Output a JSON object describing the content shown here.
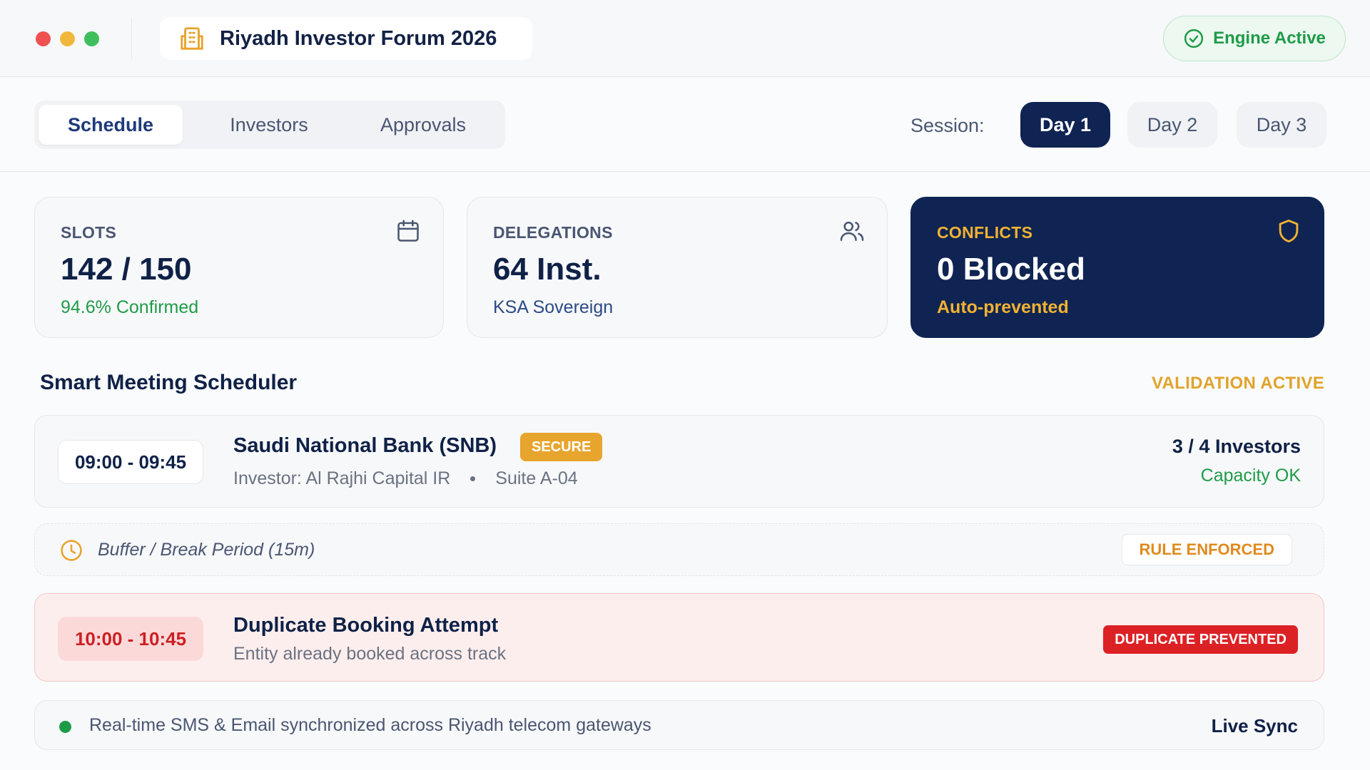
{
  "window": {
    "title": "Riyadh Investor Forum 2026",
    "app_icon": "building-icon",
    "engine_status": "Engine Active",
    "engine_icon": "check-circle-icon"
  },
  "nav": {
    "tabs": [
      {
        "label": "Schedule",
        "active": true
      },
      {
        "label": "Investors",
        "active": false
      },
      {
        "label": "Approvals",
        "active": false
      }
    ],
    "session_label": "Session:",
    "days": [
      {
        "label": "Day 1",
        "active": true
      },
      {
        "label": "Day 2",
        "active": false
      },
      {
        "label": "Day 3",
        "active": false
      }
    ]
  },
  "stats": [
    {
      "label": "SLOTS",
      "value": "142 / 150",
      "sub": "94.6% Confirmed",
      "icon": "calendar-icon"
    },
    {
      "label": "DELEGATIONS",
      "value": "64 Inst.",
      "sub": "KSA Sovereign",
      "icon": "users-icon"
    },
    {
      "label": "CONFLICTS",
      "value": "0 Blocked",
      "sub": "Auto-prevented",
      "icon": "shield-icon"
    }
  ],
  "scheduler": {
    "title": "Smart Meeting Scheduler",
    "status": "VALIDATION ACTIVE",
    "meeting": {
      "time": "09:00 - 09:45",
      "title": "Saudi National Bank (SNB)",
      "badge": "SECURE",
      "investor": "Investor: Al Rajhi Capital IR",
      "location": "Suite A-04",
      "capacity": "3 / 4 Investors",
      "capacity_status": "Capacity OK"
    },
    "buffer": {
      "icon": "clock-icon",
      "label": "Buffer / Break Period (15m)",
      "badge": "RULE ENFORCED"
    },
    "duplicate": {
      "time": "10:00 - 10:45",
      "title": "Duplicate Booking Attempt",
      "subtitle": "Entity already booked across track",
      "badge": "DUPLICATE PREVENTED"
    },
    "sync": {
      "text": "Real-time SMS & Email synchronized across Riyadh telecom gateways",
      "status": "Live Sync"
    }
  },
  "colors": {
    "navy": "#0f2452",
    "gold": "#f2b233",
    "green": "#1f9b48",
    "red": "#dc2125"
  }
}
